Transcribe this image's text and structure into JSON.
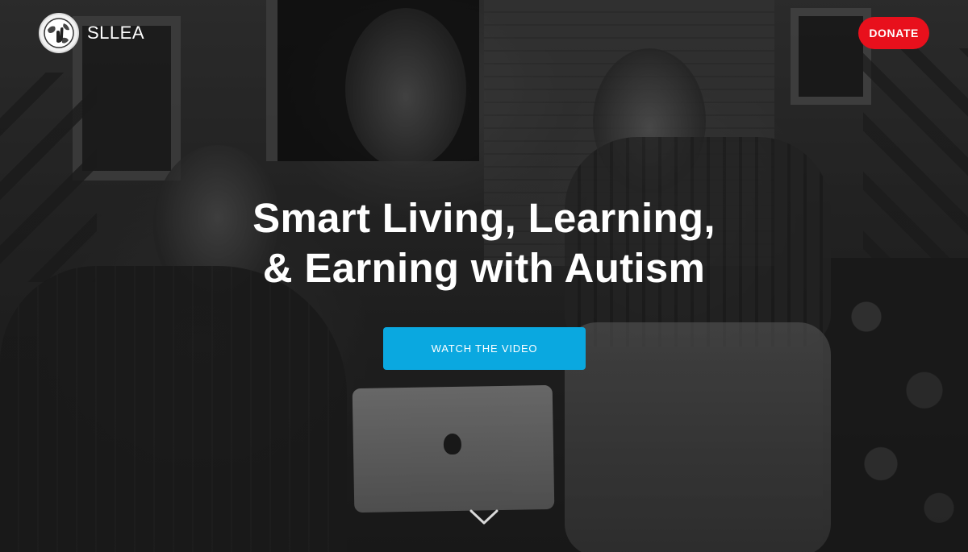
{
  "header": {
    "logo_text": "SLLEA",
    "logo_icon": "globe-hand-icon",
    "donate_label": "DONATE"
  },
  "hero": {
    "headline_line1": "Smart Living, Learning,",
    "headline_line2": "& Earning with Autism",
    "cta_label": "WATCH THE VIDEO",
    "scroll_icon": "chevron-down-icon"
  },
  "colors": {
    "donate": "#e8101c",
    "cta": "#0aa8e0",
    "text": "#ffffff"
  }
}
